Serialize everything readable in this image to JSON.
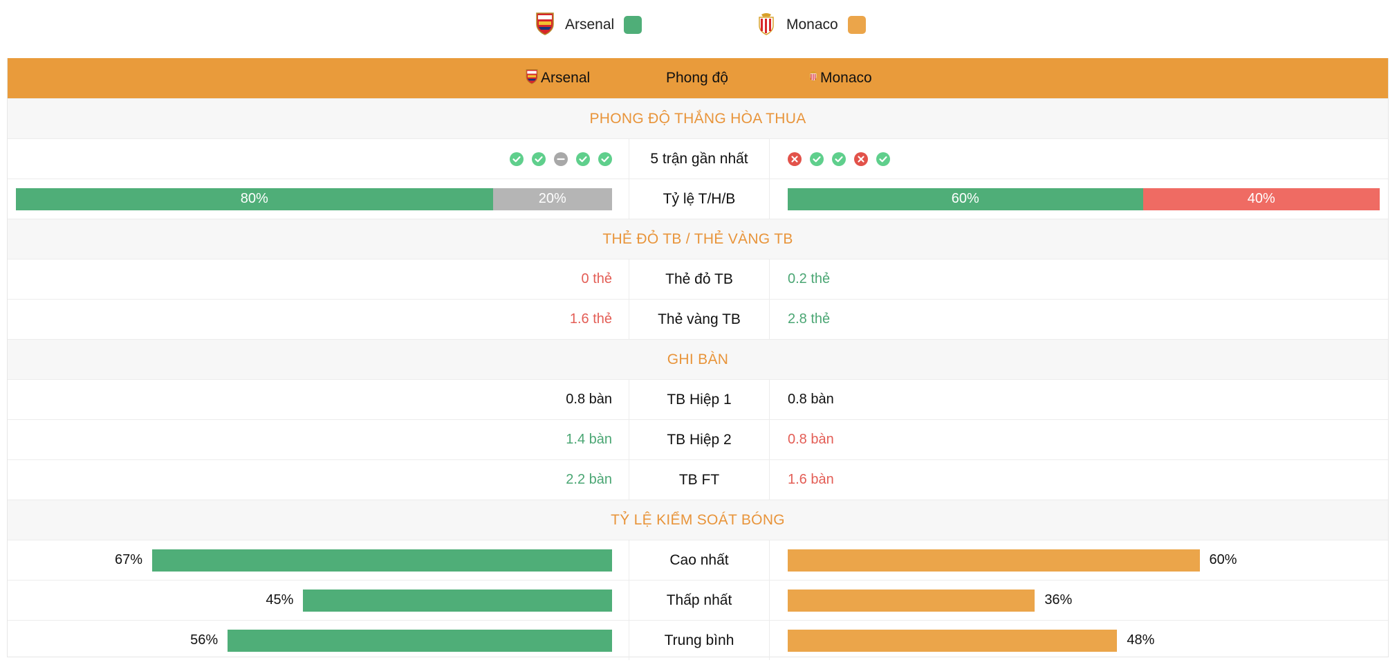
{
  "legend": {
    "home": {
      "name": "Arsenal",
      "color": "#4fae78",
      "crest_icon": "arsenal-crest-icon"
    },
    "away": {
      "name": "Monaco",
      "color": "#eba54a",
      "crest_icon": "monaco-crest-icon"
    }
  },
  "header": {
    "home": "Arsenal",
    "middle": "Phong độ",
    "away": "Monaco",
    "bg_color": "#e99b3b"
  },
  "sections": {
    "form": "PHONG ĐỘ THẮNG HÒA THUA",
    "cards": "THẺ ĐỎ TB / THẺ VÀNG TB",
    "goals": "GHI BÀN",
    "possession": "TỶ LỆ KIỂM SOÁT BÓNG"
  },
  "form": {
    "label": "5 trận gần nhất",
    "home": [
      "win",
      "win",
      "draw",
      "win",
      "win"
    ],
    "away": [
      "loss",
      "win",
      "win",
      "loss",
      "win"
    ]
  },
  "ratio": {
    "label": "Tỷ lệ T/H/B",
    "home": {
      "win": 80,
      "draw": 20,
      "loss": 0,
      "win_text": "80%",
      "draw_text": "20%"
    },
    "away": {
      "win": 60,
      "draw": 0,
      "loss": 40,
      "win_text": "60%",
      "loss_text": "40%"
    }
  },
  "cards": {
    "red": {
      "label": "Thẻ đỏ TB",
      "home": "0 thẻ",
      "away": "0.2 thẻ"
    },
    "yellow": {
      "label": "Thẻ vàng TB",
      "home": "1.6 thẻ",
      "away": "2.8 thẻ"
    }
  },
  "goals": {
    "h1": {
      "label": "TB Hiệp 1",
      "home": "0.8 bàn",
      "away": "0.8 bàn"
    },
    "h2": {
      "label": "TB Hiệp 2",
      "home": "1.4 bàn",
      "away": "0.8 bàn"
    },
    "ft": {
      "label": "TB FT",
      "home": "2.2 bàn",
      "away": "1.6 bàn"
    }
  },
  "possession": {
    "max": {
      "label": "Cao nhất",
      "home": 67,
      "away": 60,
      "home_text": "67%",
      "away_text": "60%"
    },
    "min": {
      "label": "Thấp nhất",
      "home": 45,
      "away": 36,
      "home_text": "45%",
      "away_text": "36%"
    },
    "avg": {
      "label": "Trung bình",
      "home": 56,
      "away": 48,
      "home_text": "56%",
      "away_text": "48%"
    }
  },
  "colors": {
    "accent": "#e8943a",
    "win": "#4fae78",
    "draw": "#b5b5b5",
    "loss": "#ef6b63",
    "home_bar": "#4fae78",
    "away_bar": "#eba54a"
  }
}
